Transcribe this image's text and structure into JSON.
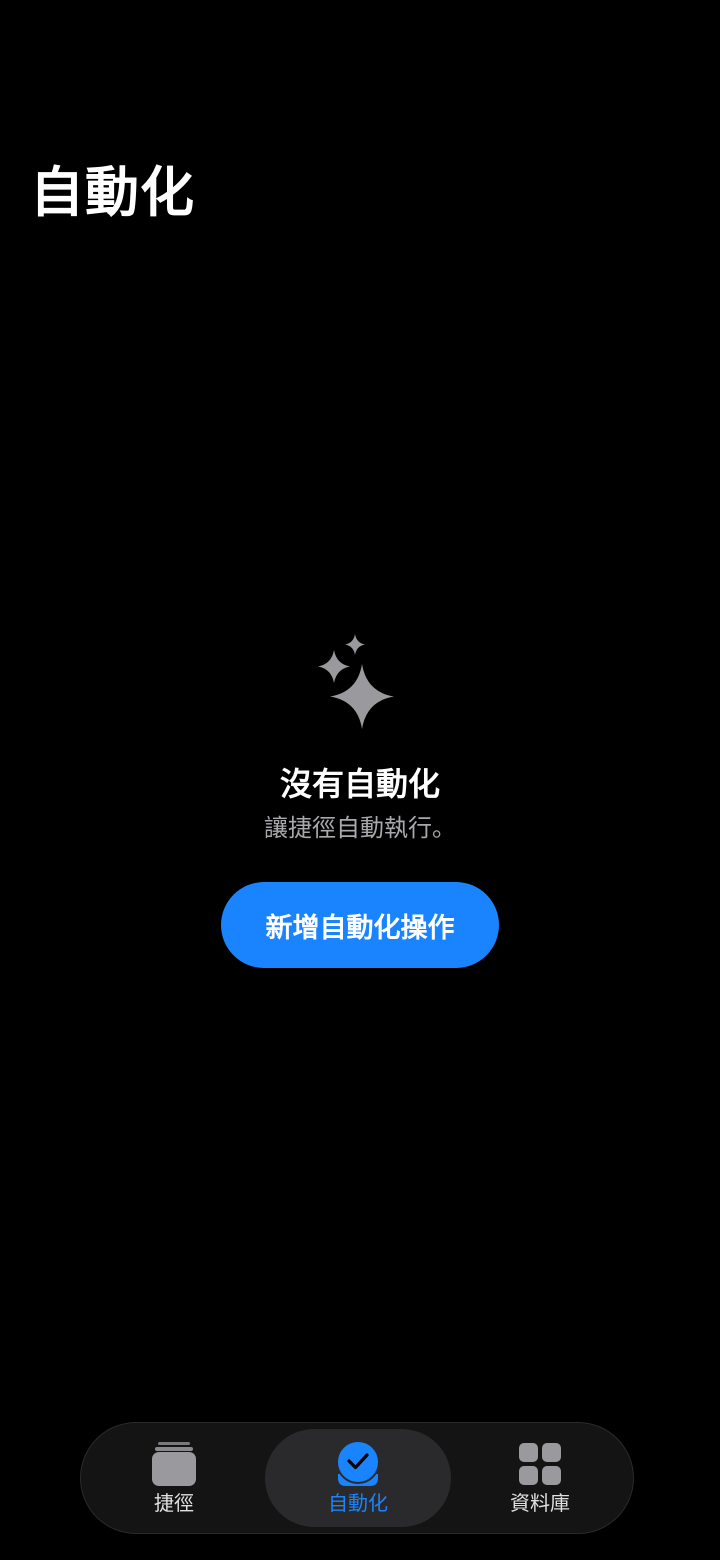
{
  "header": {
    "title": "自動化"
  },
  "empty_state": {
    "icon": "sparkles-icon",
    "title": "沒有自動化",
    "subtitle": "讓捷徑自動執行。",
    "button_label": "新增自動化操作"
  },
  "tab_bar": {
    "tabs": [
      {
        "label": "捷徑",
        "icon": "shortcuts-stack-icon",
        "selected": false
      },
      {
        "label": "自動化",
        "icon": "automation-check-icon",
        "selected": true
      },
      {
        "label": "資料庫",
        "icon": "gallery-grid-icon",
        "selected": false
      }
    ]
  },
  "colors": {
    "background": "#000000",
    "accent": "#1a84ff",
    "secondary_text": "#a8a8ad",
    "icon_gray": "#9a9a9e"
  }
}
